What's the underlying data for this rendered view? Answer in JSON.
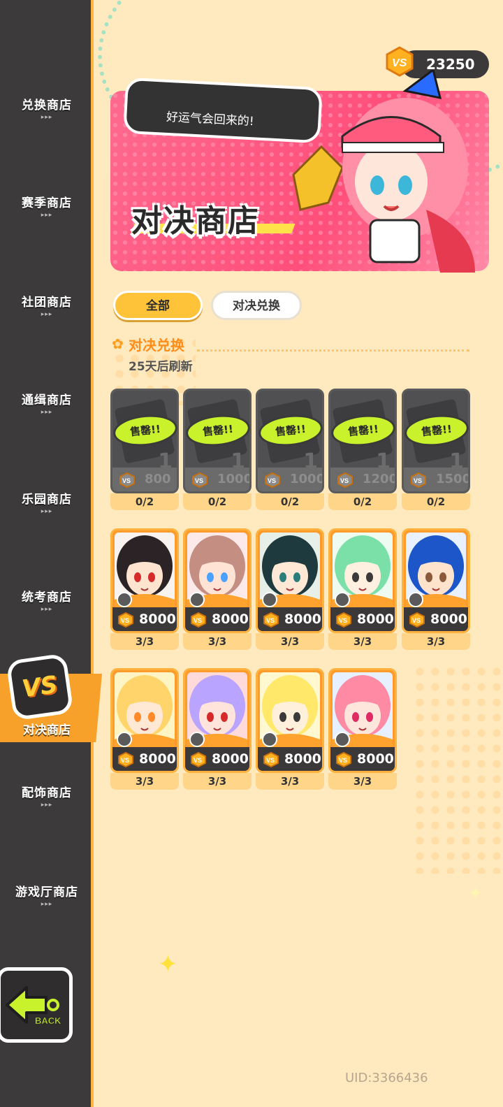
{
  "currency": {
    "amount": "23250",
    "icon": "vs-coin-icon"
  },
  "sidebar": {
    "items": [
      {
        "label": "兑换商店",
        "arrows": "▸▸▸"
      },
      {
        "label": "赛季商店",
        "arrows": "▸▸▸"
      },
      {
        "label": "社团商店",
        "arrows": "▸▸▸"
      },
      {
        "label": "通缉商店",
        "arrows": "▸▸▸"
      },
      {
        "label": "乐园商店",
        "arrows": "▸▸▸"
      },
      {
        "label": "统考商店",
        "arrows": "▸▸▸"
      },
      {
        "label": "配饰商店",
        "arrows": "▸▸▸"
      },
      {
        "label": "游戏厅商店",
        "arrows": "▸▸▸"
      }
    ],
    "active": {
      "label": "对决商店",
      "badge": "VS"
    },
    "back_label": "BACK"
  },
  "banner": {
    "title": "对决商店",
    "speech": "好运气会回来的!"
  },
  "tabs": [
    {
      "label": "全部",
      "selected": true
    },
    {
      "label": "对决兑换",
      "selected": false
    }
  ],
  "section": {
    "title": "对决兑换",
    "refresh": "25天后刷新"
  },
  "soldout_items": [
    {
      "tag": "售罄!!",
      "qty": "1",
      "price": "800",
      "limit": "0/2"
    },
    {
      "tag": "售罄!!",
      "qty": "1",
      "price": "1000",
      "limit": "0/2"
    },
    {
      "tag": "售罄!!",
      "qty": "1",
      "price": "1000",
      "limit": "0/2"
    },
    {
      "tag": "售罄!!",
      "qty": "1",
      "price": "1200",
      "limit": "0/2"
    },
    {
      "tag": "售罄!!",
      "qty": "1",
      "price": "1500",
      "limit": "0/2"
    }
  ],
  "avatar_items": [
    {
      "price": "8000",
      "limit": "3/3",
      "hair": "#2b2326",
      "skin": "#ffe4cf",
      "bg": "#f8f3ef",
      "accent": "#d52b2b"
    },
    {
      "price": "8000",
      "limit": "3/3",
      "hair": "#c48e83",
      "skin": "#ffe4d6",
      "bg": "#fce9ea",
      "accent": "#4aa2ff"
    },
    {
      "price": "8000",
      "limit": "3/3",
      "hair": "#1f3a3e",
      "skin": "#ffe8d6",
      "bg": "#e6efe8",
      "accent": "#2a7d7a"
    },
    {
      "price": "8000",
      "limit": "3/3",
      "hair": "#7be0a8",
      "skin": "#fff0e0",
      "bg": "#eefbf0",
      "accent": "#3a3a3a"
    },
    {
      "price": "8000",
      "limit": "3/3",
      "hair": "#1c56c9",
      "skin": "#ffe3cc",
      "bg": "#e9f1ff",
      "accent": "#8a5a3a"
    },
    {
      "price": "8000",
      "limit": "3/3",
      "hair": "#ffd46a",
      "skin": "#ffe9d4",
      "bg": "#fff5c4",
      "accent": "#ff8a2a"
    },
    {
      "price": "8000",
      "limit": "3/3",
      "hair": "#b9a4ff",
      "skin": "#ffe4dc",
      "bg": "#ffdada",
      "accent": "#d62a2a"
    },
    {
      "price": "8000",
      "limit": "3/3",
      "hair": "#ffe86a",
      "skin": "#fff0dc",
      "bg": "#fff8d0",
      "accent": "#3a3a3a"
    },
    {
      "price": "8000",
      "limit": "3/3",
      "hair": "#ff8aa4",
      "skin": "#ffe6dc",
      "bg": "#e6f0ff",
      "accent": "#e02a64"
    }
  ],
  "uid": "UID:3366436"
}
